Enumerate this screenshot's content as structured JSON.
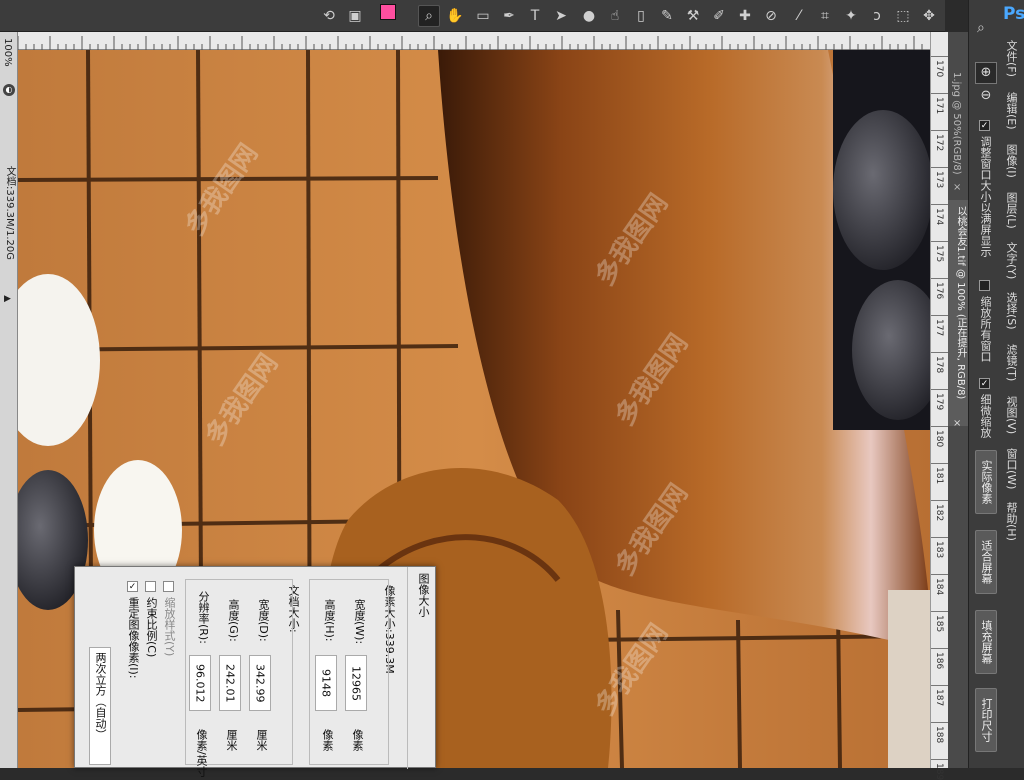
{
  "toolbar": {
    "tools": [
      "rotate-view-icon",
      "screen-mode-icon",
      "color-swatch",
      "zoom-tool-icon",
      "hand-tool-icon",
      "gradient-tool-icon",
      "pen-tool-icon",
      "type-tool-icon",
      "path-select-icon",
      "dodge-tool-icon",
      "smudge-tool-icon",
      "eraser-tool-icon",
      "history-brush-icon",
      "clone-stamp-icon",
      "brush-tool-icon",
      "healing-brush-icon",
      "eyedropper-tool-icon",
      "crop-tool-icon",
      "magic-wand-icon",
      "lasso-tool-icon",
      "marquee-tool-icon",
      "move-tool-icon"
    ],
    "foreground_color": "#ff4fa0",
    "background_color": "#ffffff"
  },
  "left_ruler": {
    "zoom": "100%",
    "doc_info": "文档:339.3M/1.20G"
  },
  "right_ruler": {
    "ticks": [
      "170",
      "171",
      "172",
      "173",
      "174",
      "175",
      "176",
      "177",
      "178",
      "179",
      "180",
      "181",
      "182",
      "183",
      "184",
      "185",
      "186",
      "187",
      "188",
      "189"
    ]
  },
  "tabs": {
    "tab1": "1.jpg @ 50%(RGB/8)",
    "tab1_close": "×",
    "tab2": "以桃会友1.tif @ 100% (正在提升, RGB/8)",
    "tab2_close": "×"
  },
  "app": {
    "logo": "Ps",
    "search_icon": "search-icon"
  },
  "menu": {
    "items": [
      "文件(F)",
      "编辑(E)",
      "图像(I)",
      "图层(L)",
      "文字(Y)",
      "选择(S)",
      "滤镜(T)",
      "视图(V)",
      "窗口(W)",
      "帮助(H)"
    ]
  },
  "options": {
    "resize_windows": "调整窗口大小以满屏显示",
    "zoom_all": "缩放所有窗口",
    "scrubby_zoom": "细微缩放",
    "btn_actual_pixels": "实际像素",
    "btn_fit_screen": "适合屏幕",
    "btn_fill_screen": "填充屏幕",
    "btn_print_size": "打印尺寸"
  },
  "dialog": {
    "title": "图像大小",
    "pixel_dimensions": "像素大小:339.3M",
    "width_label": "宽度(W):",
    "width_value": "12965",
    "width_unit": "像素",
    "height_label": "高度(H):",
    "height_value": "9148",
    "height_unit": "像素",
    "doc_size": "文档大小:",
    "doc_width_label": "宽度(D):",
    "doc_width_value": "342.99",
    "doc_width_unit": "厘米",
    "doc_height_label": "高度(G):",
    "doc_height_value": "242.01",
    "doc_height_unit": "厘米",
    "resolution_label": "分辨率(R):",
    "resolution_value": "96.012",
    "resolution_unit": "像素/英寸",
    "scale_styles": "缩放样式(Y)",
    "constrain": "约束比例(C)",
    "resample": "重定图像像素(I):",
    "resample_method": "两次立方（自动）"
  },
  "watermark": "多我图网"
}
